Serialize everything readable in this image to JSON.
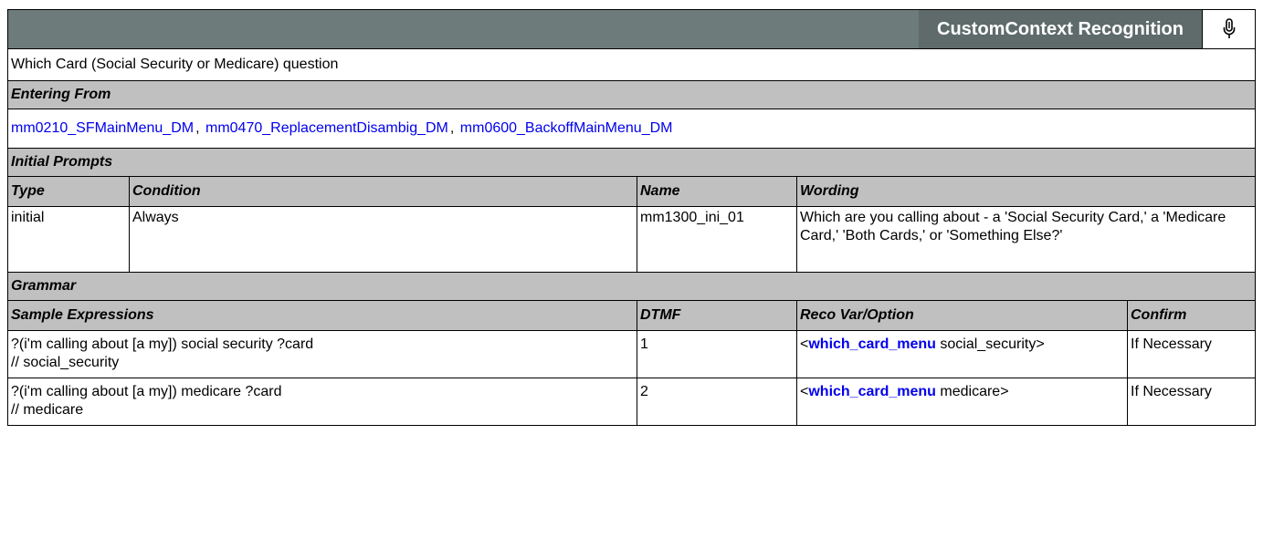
{
  "header": {
    "title": "CustomContext Recognition",
    "icon": "microphone-icon"
  },
  "description": "Which Card (Social Security or Medicare) question",
  "entering_from": {
    "label": "Entering From",
    "links": [
      "mm0210_SFMainMenu_DM",
      "mm0470_ReplacementDisambig_DM",
      "mm0600_BackoffMainMenu_DM"
    ],
    "separator": ","
  },
  "initial_prompts": {
    "label": "Initial Prompts",
    "columns": [
      "Type",
      "Condition",
      "Name",
      "Wording"
    ],
    "rows": [
      {
        "type": "initial",
        "condition": "Always",
        "name": "mm1300_ini_01",
        "wording": "Which are you calling about - a 'Social Security Card,' a 'Medicare Card,' 'Both Cards,' or 'Something Else?'"
      }
    ]
  },
  "grammar": {
    "label": "Grammar",
    "columns": [
      "Sample Expressions",
      "DTMF",
      "Reco Var/Option",
      "Confirm"
    ],
    "rows": [
      {
        "expr_line1": "?(i'm calling about [a my]) social security ?card",
        "expr_line2": "// social_security",
        "dtmf": "1",
        "reco_open": "<",
        "reco_var": "which_card_menu",
        "reco_value": " social_security>",
        "confirm": "If Necessary"
      },
      {
        "expr_line1": "?(i'm calling about [a my]) medicare ?card",
        "expr_line2": "// medicare",
        "dtmf": "2",
        "reco_open": "<",
        "reco_var": "which_card_menu",
        "reco_value": " medicare>",
        "confirm": "If Necessary"
      }
    ]
  }
}
